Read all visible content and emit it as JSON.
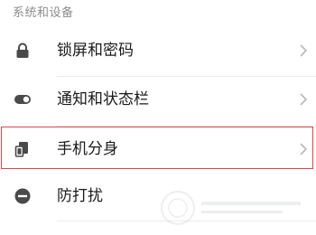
{
  "section": {
    "title": "系统和设备"
  },
  "items": [
    {
      "label": "锁屏和密码",
      "icon": "lock-icon",
      "chevron": true
    },
    {
      "label": "通知和状态栏",
      "icon": "toggle-icon",
      "chevron": true
    },
    {
      "label": "手机分身",
      "icon": "second-space-icon",
      "chevron": true,
      "highlighted": true
    },
    {
      "label": "防打扰",
      "icon": "do-not-disturb-icon",
      "chevron": false
    }
  ],
  "colors": {
    "icon": "#4a4a4a",
    "chevron": "#b8b8b8",
    "highlight": "#d9484b",
    "section_header": "#8c8c8c"
  }
}
